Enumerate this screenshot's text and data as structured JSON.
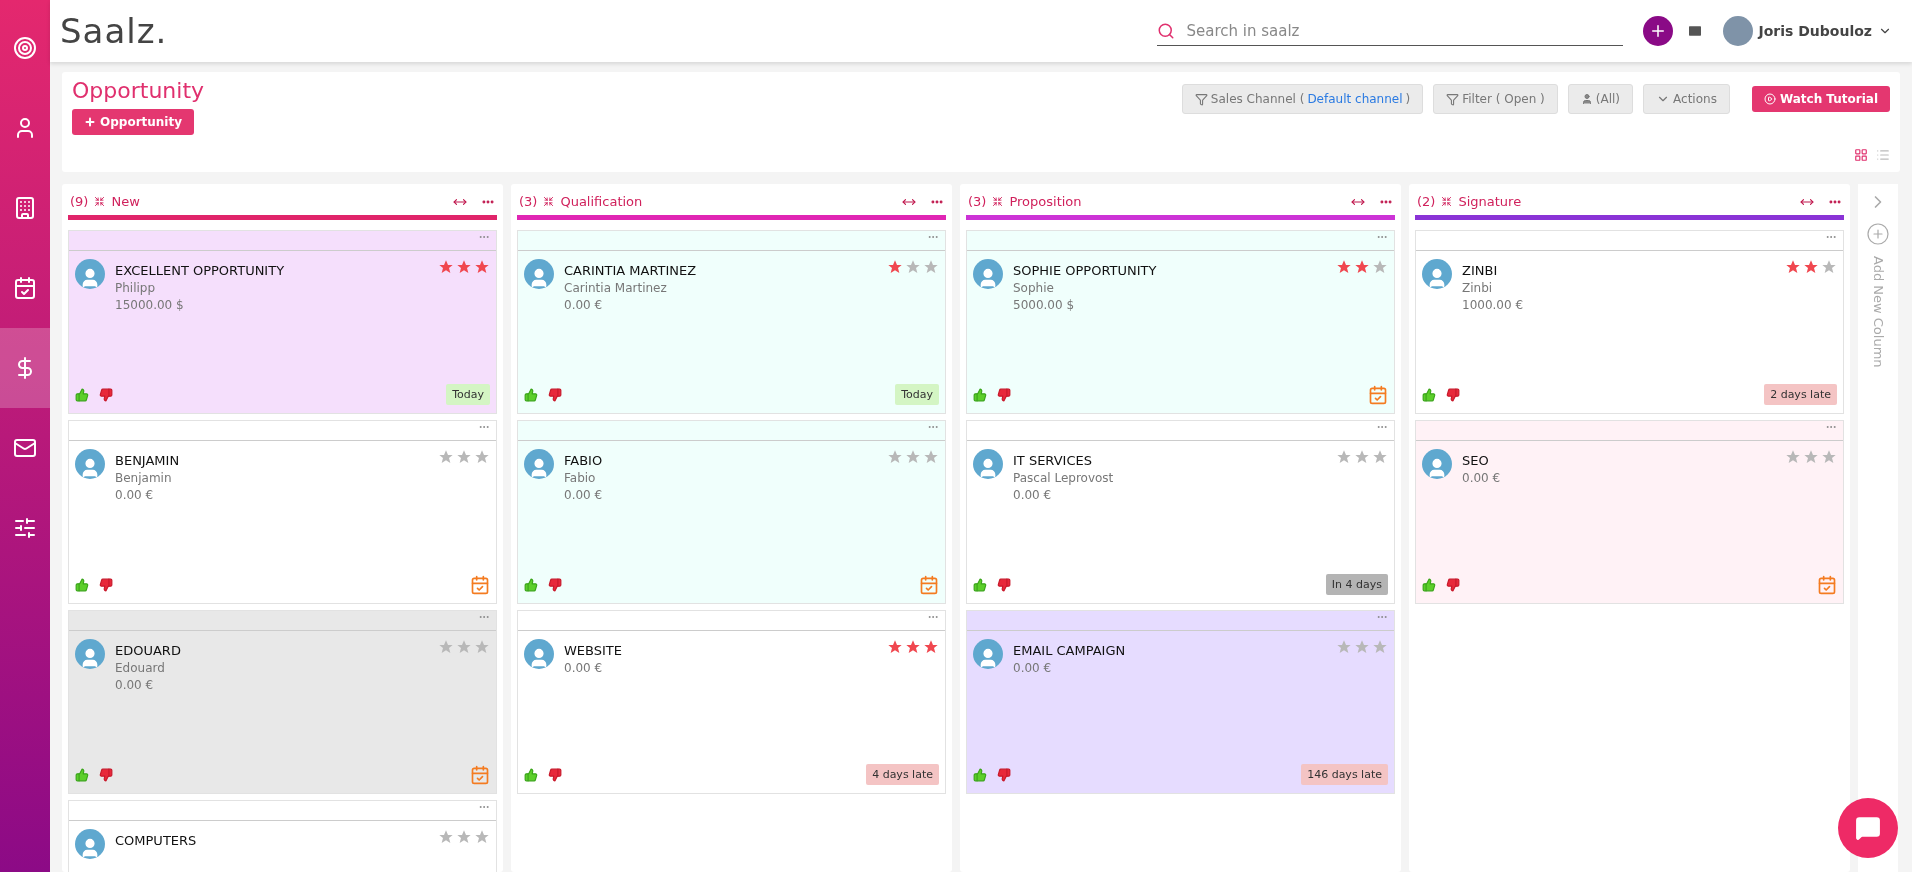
{
  "sidebar": {
    "items": [
      {
        "selected": false
      },
      {
        "selected": false
      },
      {
        "selected": false
      },
      {
        "selected": false
      },
      {
        "selected": true
      },
      {
        "selected": false
      },
      {
        "selected": false
      }
    ]
  },
  "topbar": {
    "logo": "Saalz.",
    "search": {
      "placeholder": "Search in saalz"
    },
    "user": "Joris Dubouloz"
  },
  "header": {
    "title": "Opportunity",
    "add_button": "Opportunity",
    "toolbar": [
      {
        "kind": "filter",
        "label": "Sales Channel ( ",
        "link": "Default channel",
        "suffix": " )"
      },
      {
        "kind": "filter",
        "label": "Filter ( Open )"
      },
      {
        "kind": "user",
        "label": "(All)"
      },
      {
        "kind": "dropdown",
        "label": "Actions"
      }
    ],
    "tutorial": "Watch Tutorial",
    "views": [
      {
        "selected": true
      },
      {
        "selected": false
      }
    ]
  },
  "columns": [
    {
      "count": "(9)",
      "name": "New",
      "color": "#e0246a",
      "cards": [
        {
          "title": "EXCELLENT OPPORTUNITY",
          "contact": "Philipp",
          "amount": "15000.00 $",
          "stars": 3,
          "color": "#f5dffc",
          "due": {
            "kind": "today",
            "label": "Today"
          }
        },
        {
          "title": "BENJAMIN",
          "contact": "Benjamin",
          "amount": "0.00 €",
          "stars": 0,
          "color": "#ffffff",
          "due": {
            "kind": "calendar"
          }
        },
        {
          "title": "EDOUARD",
          "contact": "Edouard",
          "amount": "0.00 €",
          "stars": 0,
          "color": "#e8e8e8",
          "due": {
            "kind": "calendar"
          }
        },
        {
          "title": "COMPUTERS",
          "stars": 0,
          "color": "#ffffff"
        }
      ]
    },
    {
      "count": "(3)",
      "name": "Qualification",
      "color": "#e026b4",
      "cards": [
        {
          "title": "CARINTIA MARTINEZ",
          "contact": "Carintia Martinez",
          "amount": "0.00 €",
          "stars": 1,
          "color": "#f0fffc",
          "due": {
            "kind": "today",
            "label": "Today"
          }
        },
        {
          "title": "FABIO",
          "contact": "Fabio",
          "amount": "0.00 €",
          "stars": 0,
          "color": "#f0fffc",
          "due": {
            "kind": "calendar"
          }
        },
        {
          "title": "WEBSITE",
          "amount": "0.00 €",
          "stars": 3,
          "color": "#ffffff",
          "due": {
            "kind": "late",
            "label": "4 days late"
          }
        }
      ]
    },
    {
      "count": "(3)",
      "name": "Proposition",
      "color": "#cc33d6",
      "cards": [
        {
          "title": "SOPHIE OPPORTUNITY",
          "contact": "Sophie",
          "amount": "5000.00 $",
          "stars": 2,
          "color": "#f0fffc",
          "due": {
            "kind": "calendar"
          }
        },
        {
          "title": "IT SERVICES",
          "contact": "Pascal Leprovost",
          "amount": "0.00 €",
          "stars": 0,
          "color": "#ffffff",
          "due": {
            "kind": "future",
            "label": "In 4 days"
          }
        },
        {
          "title": "EMAIL CAMPAIGN",
          "amount": "0.00 €",
          "stars": 0,
          "color": "#e6dcff",
          "due": {
            "kind": "late",
            "label": "146 days late"
          }
        }
      ]
    },
    {
      "count": "(2)",
      "name": "Signature",
      "color": "#8a33d6",
      "cards": [
        {
          "title": "ZINBI",
          "contact": "Zinbi",
          "amount": "1000.00 €",
          "stars": 2,
          "color": "#ffffff",
          "due": {
            "kind": "late",
            "label": "2 days late"
          }
        },
        {
          "title": "SEO",
          "amount": "0.00 €",
          "stars": 0,
          "color": "#fff2f6",
          "due": {
            "kind": "calendar"
          }
        }
      ]
    }
  ],
  "add_column": "Add New Column"
}
